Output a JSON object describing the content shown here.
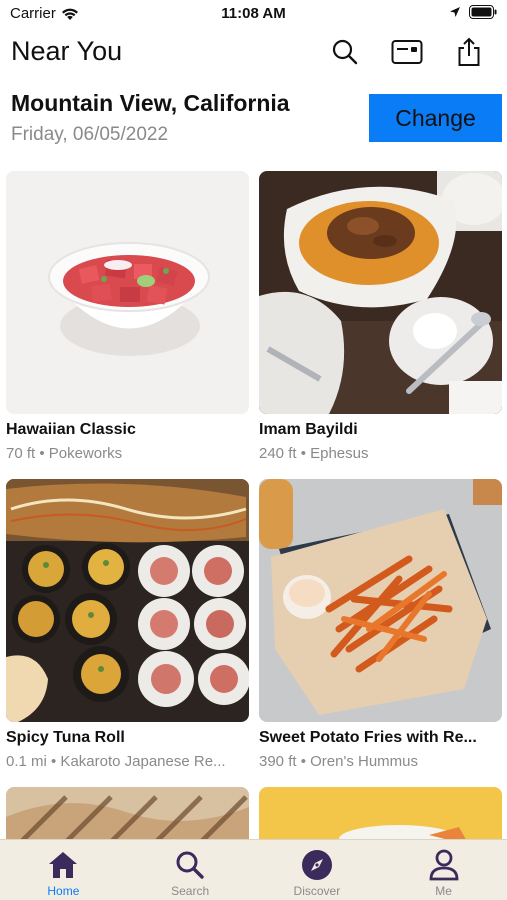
{
  "status_bar": {
    "carrier": "Carrier",
    "time": "11:08 AM"
  },
  "header": {
    "title": "Near You",
    "icons": [
      "search-icon",
      "card-icon",
      "share-icon"
    ]
  },
  "location": {
    "city": "Mountain View, California",
    "date": "Friday, 06/05/2022",
    "change_label": "Change"
  },
  "items": [
    {
      "name": "Hawaiian Classic",
      "meta": "70 ft • Pokeworks"
    },
    {
      "name": "Imam Bayildi",
      "meta": "240 ft • Ephesus"
    },
    {
      "name": "Spicy Tuna Roll",
      "meta": "0.1 mi • Kakaroto Japanese Re..."
    },
    {
      "name": "Sweet Potato Fries with Re...",
      "meta": "390 ft • Oren's Hummus"
    }
  ],
  "tabs": [
    {
      "label": "Home",
      "icon": "home-icon",
      "active": true
    },
    {
      "label": "Search",
      "icon": "search-icon",
      "active": false
    },
    {
      "label": "Discover",
      "icon": "compass-icon",
      "active": false
    },
    {
      "label": "Me",
      "icon": "person-icon",
      "active": false
    }
  ],
  "colors": {
    "accent": "#0a7cf5",
    "tab_icon": "#3b2a5c",
    "tab_bar_bg": "#f2ede3"
  }
}
